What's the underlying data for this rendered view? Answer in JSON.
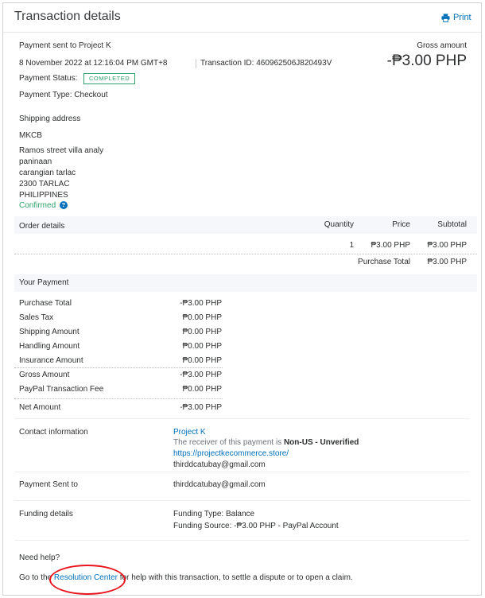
{
  "header": {
    "title": "Transaction details",
    "print_label": "Print"
  },
  "summary": {
    "payment_to": "Payment sent to Project K",
    "datetime": "8 November 2022 at 12:16:04 PM GMT+8",
    "transaction_id": "Transaction ID: 460962506J820493V",
    "status_label": "Payment Status:",
    "status_badge": "COMPLETED",
    "payment_type": "Payment Type: Checkout",
    "gross_label": "Gross amount",
    "gross_value": "-₱3.00 PHP"
  },
  "shipping": {
    "heading": "Shipping address",
    "name": "MKCB",
    "lines": [
      "Ramos street villa analy",
      "paninaan",
      "carangian tarlac",
      "2300 TARLAC",
      "PHILIPPINES"
    ],
    "confirmed": "Confirmed"
  },
  "order": {
    "heading": "Order details",
    "col_quantity": "Quantity",
    "col_price": "Price",
    "col_subtotal": "Subtotal",
    "row": {
      "quantity": "1",
      "price": "₱3.00 PHP",
      "subtotal": "₱3.00 PHP"
    },
    "total_label": "Purchase Total",
    "total_value": "₱3.00 PHP"
  },
  "payment": {
    "heading": "Your Payment",
    "rows": [
      {
        "label": "Purchase Total",
        "value": "-₱3.00 PHP"
      },
      {
        "label": "Sales Tax",
        "value": "₱0.00 PHP"
      },
      {
        "label": "Shipping Amount",
        "value": "₱0.00 PHP"
      },
      {
        "label": "Handling Amount",
        "value": "₱0.00 PHP"
      },
      {
        "label": "Insurance Amount",
        "value": "₱0.00 PHP"
      },
      {
        "label": "Gross Amount",
        "value": "-₱3.00 PHP"
      },
      {
        "label": "PayPal Transaction Fee",
        "value": "₱0.00 PHP"
      },
      {
        "label": "Net Amount",
        "value": "-₱3.00 PHP"
      }
    ]
  },
  "contact": {
    "heading": "Contact information",
    "name": "Project K",
    "receiver_prefix": "The receiver of this payment is",
    "receiver_status": "Non-US - Unverified",
    "website": "https://projectkecommerce.store/",
    "email": "thirddcatubay@gmail.com"
  },
  "sent_to": {
    "heading": "Payment Sent to",
    "email": "thirddcatubay@gmail.com"
  },
  "funding": {
    "heading": "Funding details",
    "type": "Funding Type: Balance",
    "source": "Funding Source: -₱3.00 PHP - PayPal Account"
  },
  "help": {
    "heading": "Need help?",
    "prefix": "Go to the",
    "link": "Resolution Center",
    "suffix": "for help with this transaction, to settle a dispute or to open a claim."
  },
  "colors": {
    "link": "#0070ba",
    "completed": "#2fa36b",
    "annotation_circle": "#e8141b"
  },
  "icons": {
    "print": "printer-icon",
    "help": "question-circle-icon"
  }
}
